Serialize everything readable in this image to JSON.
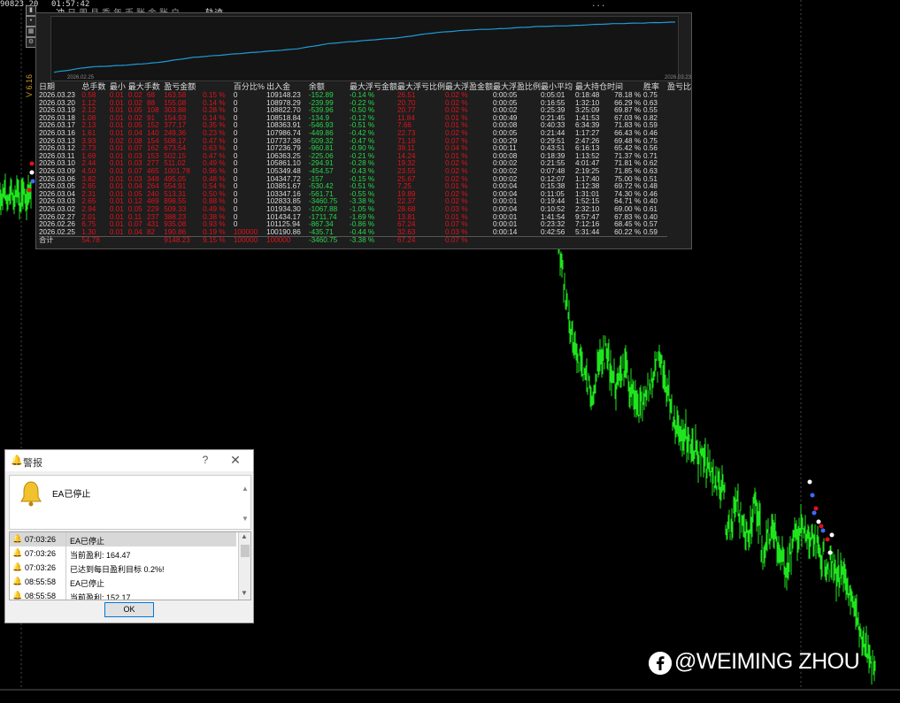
{
  "topbar": {
    "price": "90823.20",
    "time": "01:57:42",
    "right_text": "..."
  },
  "tabs_left": [
    "冲",
    "日",
    "周",
    "月",
    "季",
    "年",
    "币",
    "账",
    "金",
    "账",
    "户"
  ],
  "tab_track": "轨迹",
  "version": "V 6.16",
  "toolbar_icons": [
    "chart-icon",
    "dot-icon",
    "grid-icon",
    "settings-icon"
  ],
  "equity_curve": {
    "start_date": "2026.02.25",
    "end_date": "2026.03.23",
    "line_color": "#1e9bd6"
  },
  "table": {
    "headers": [
      "日期",
      "总手数",
      "最小",
      "最大手数",
      "盈亏金额",
      "百分比%",
      "出入金",
      "余额",
      "最大浮亏金额",
      "最大浮亏比例",
      "最大浮盈金额",
      "最大浮盈比例",
      "最小平均",
      "最大持仓时间",
      "胜率",
      "盈亏比"
    ],
    "rows": [
      [
        "2026.03.23",
        "0.58",
        "0.01",
        "0.02",
        "68",
        "163.58",
        "0.15 %",
        "0",
        "109148.23",
        "-152.89",
        "-0.14 %",
        "26.51",
        "0.02 %",
        "0:00:05",
        "0:05:01",
        "0:18:48",
        "78.18 %",
        "0.75"
      ],
      [
        "2026.03.20",
        "1.12",
        "0.01",
        "0.02",
        "88",
        "155.08",
        "0.14 %",
        "0",
        "108978.29",
        "-239.99",
        "-0.22 %",
        "20.70",
        "0.02 %",
        "0:00:05",
        "0:16:55",
        "1:32:10",
        "66.29 %",
        "0.63"
      ],
      [
        "2026.03.19",
        "2.12",
        "0.01",
        "0.05",
        "108",
        "303.88",
        "0.28 %",
        "0",
        "108822.70",
        "-539.96",
        "-0.50 %",
        "20.77",
        "0.02 %",
        "0:00:02",
        "0:25:39",
        "3:25:09",
        "69.87 %",
        "0.55"
      ],
      [
        "2026.03.18",
        "1.08",
        "0.01",
        "0.02",
        "91",
        "154.93",
        "0.14 %",
        "0",
        "108518.84",
        "-134.9",
        "-0.12 %",
        "11.84",
        "0.01 %",
        "0:00:49",
        "0:21:45",
        "1:41:53",
        "67.03 %",
        "0.82"
      ],
      [
        "2026.03.17",
        "2.13",
        "0.01",
        "0.05",
        "152",
        "377.17",
        "0.35 %",
        "0",
        "108363.91",
        "-546.93",
        "-0.51 %",
        "7.66",
        "0.01 %",
        "0:00:08",
        "0:40:33",
        "6:34:39",
        "71.83 %",
        "0.59"
      ],
      [
        "2026.03.16",
        "1.61",
        "0.01",
        "0.04",
        "140",
        "249.36",
        "0.23 %",
        "0",
        "107986.74",
        "-449.86",
        "-0.42 %",
        "22.73",
        "0.02 %",
        "0:00:05",
        "0:21:44",
        "1:17:27",
        "66.43 %",
        "0.46"
      ],
      [
        "2026.03.13",
        "3.93",
        "0.02",
        "0.08",
        "154",
        "508.17",
        "0.47 %",
        "0",
        "107737.36",
        "-509.32",
        "-0.47 %",
        "71.16",
        "0.07 %",
        "0:00:29",
        "0:29:51",
        "2:47:26",
        "69.48 %",
        "0.75"
      ],
      [
        "2026.03.12",
        "2.73",
        "0.01",
        "0.07",
        "162",
        "673.54",
        "0.63 %",
        "0",
        "107236.79",
        "-960.81",
        "-0.90 %",
        "39.11",
        "0.04 %",
        "0:00:11",
        "0:43:51",
        "6:16:13",
        "65.42 %",
        "0.56"
      ],
      [
        "2026.03.11",
        "1.69",
        "0.01",
        "0.03",
        "153",
        "502.15",
        "0.47 %",
        "0",
        "106363.25",
        "-225.06",
        "-0.21 %",
        "14.24",
        "0.01 %",
        "0:00:08",
        "0:18:39",
        "1:13:52",
        "71.37 %",
        "0.71"
      ],
      [
        "2026.03.10",
        "2.44",
        "0.01",
        "0.03",
        "277",
        "511.02",
        "0.49 %",
        "0",
        "105861.10",
        "-294.91",
        "-0.28 %",
        "19.32",
        "0.02 %",
        "0:00:02",
        "0:21:55",
        "4:01:47",
        "71.81 %",
        "0.62"
      ],
      [
        "2026.03.09",
        "4.50",
        "0.01",
        "0.07",
        "465",
        "1001.78",
        "0.96 %",
        "0",
        "105349.48",
        "-454.57",
        "-0.43 %",
        "23.55",
        "0.02 %",
        "0:00:02",
        "0:07:48",
        "2:19:25",
        "71.85 %",
        "0.63"
      ],
      [
        "2026.03.06",
        "3.82",
        "0.01",
        "0.03",
        "348",
        "495.05",
        "0.48 %",
        "0",
        "104347.72",
        "-157",
        "-0.15 %",
        "25.67",
        "0.02 %",
        "0:00:02",
        "0:12:07",
        "1:17:40",
        "75.00 %",
        "0.51"
      ],
      [
        "2026.03.05",
        "2.65",
        "0.01",
        "0.04",
        "264",
        "554.91",
        "0.54 %",
        "0",
        "103851.67",
        "-530.42",
        "-0.51 %",
        "7.25",
        "0.01 %",
        "0:00:04",
        "0:15:38",
        "1:12:38",
        "69.72 %",
        "0.48"
      ],
      [
        "2026.03.04",
        "2.31",
        "0.01",
        "0.05",
        "240",
        "513.31",
        "0.50 %",
        "0",
        "103347.16",
        "-561.71",
        "-0.55 %",
        "19.89",
        "0.02 %",
        "0:00:04",
        "0:11:05",
        "1:31:01",
        "74.30 %",
        "0.46"
      ],
      [
        "2026.03.03",
        "2.65",
        "0.01",
        "0.12",
        "469",
        "898.55",
        "0.88 %",
        "0",
        "102833.85",
        "-3460.75",
        "-3.38 %",
        "22.37",
        "0.02 %",
        "0:00:01",
        "0:19:44",
        "1:52:15",
        "64.71 %",
        "0.40"
      ],
      [
        "2026.03.02",
        "2.94",
        "0.01",
        "0.05",
        "229",
        "509.33",
        "0.49 %",
        "0",
        "101934.30",
        "-1067.88",
        "-1.05 %",
        "28.68",
        "0.03 %",
        "0:00:04",
        "0:10:52",
        "2:32:10",
        "69.00 %",
        "0.61"
      ],
      [
        "2026.02.27",
        "2.01",
        "0.01",
        "0.11",
        "237",
        "388.23",
        "0.38 %",
        "0",
        "101434.17",
        "-1711.74",
        "-1.69 %",
        "13.81",
        "0.01 %",
        "0:00:01",
        "1:41:54",
        "9:57:47",
        "67.83 %",
        "0.40"
      ],
      [
        "2026.02.26",
        "6.75",
        "0.01",
        "0.07",
        "431",
        "935.08",
        "0.93 %",
        "0",
        "101125.94",
        "-867.34",
        "-0.86 %",
        "67.24",
        "0.07 %",
        "0:00:01",
        "0:23:32",
        "7:12:16",
        "68.45 %",
        "0.57"
      ],
      [
        "2026.02.25",
        "1.30",
        "0.01",
        "0.04",
        "82",
        "190.86",
        "0.19 %",
        "100000",
        "100190.86",
        "-435.71",
        "-0.44 %",
        "32.63",
        "0.03 %",
        "0:00:14",
        "0:42:56",
        "5:31:44",
        "60.22 %",
        "0.59"
      ]
    ],
    "total": {
      "label": "合计",
      "lots": "54.78",
      "profit": "9148.23",
      "percent": "9.15 %",
      "deposit": "100000",
      "deposit2": "100000",
      "max_float_loss": "-3460.75",
      "max_float_loss_pct": "-3.38 %",
      "max_float_profit": "67.24",
      "max_float_profit_pct": "0.07 %"
    }
  },
  "alert": {
    "title": "警报",
    "help": "?",
    "close": "✕",
    "message": "EA已停止",
    "list": [
      {
        "time": "07:03:26",
        "text": "EA已停止",
        "selected": true
      },
      {
        "time": "07:03:26",
        "text": "当前盈利: 164.47",
        "selected": false
      },
      {
        "time": "07:03:26",
        "text": "已达到每日盈利目标 0.2%!",
        "selected": false
      },
      {
        "time": "08:55:58",
        "text": "EA已停止",
        "selected": false
      },
      {
        "time": "08:55:58",
        "text": "当前盈利: 152.17",
        "selected": false
      }
    ],
    "ok_label": "OK"
  },
  "watermark": "@WEIMING ZHOU",
  "colors": {
    "candle": "#1ee61e",
    "loss": "#e0121c",
    "profit": "#27d64a",
    "panel_bg": "#1e1e1e"
  }
}
